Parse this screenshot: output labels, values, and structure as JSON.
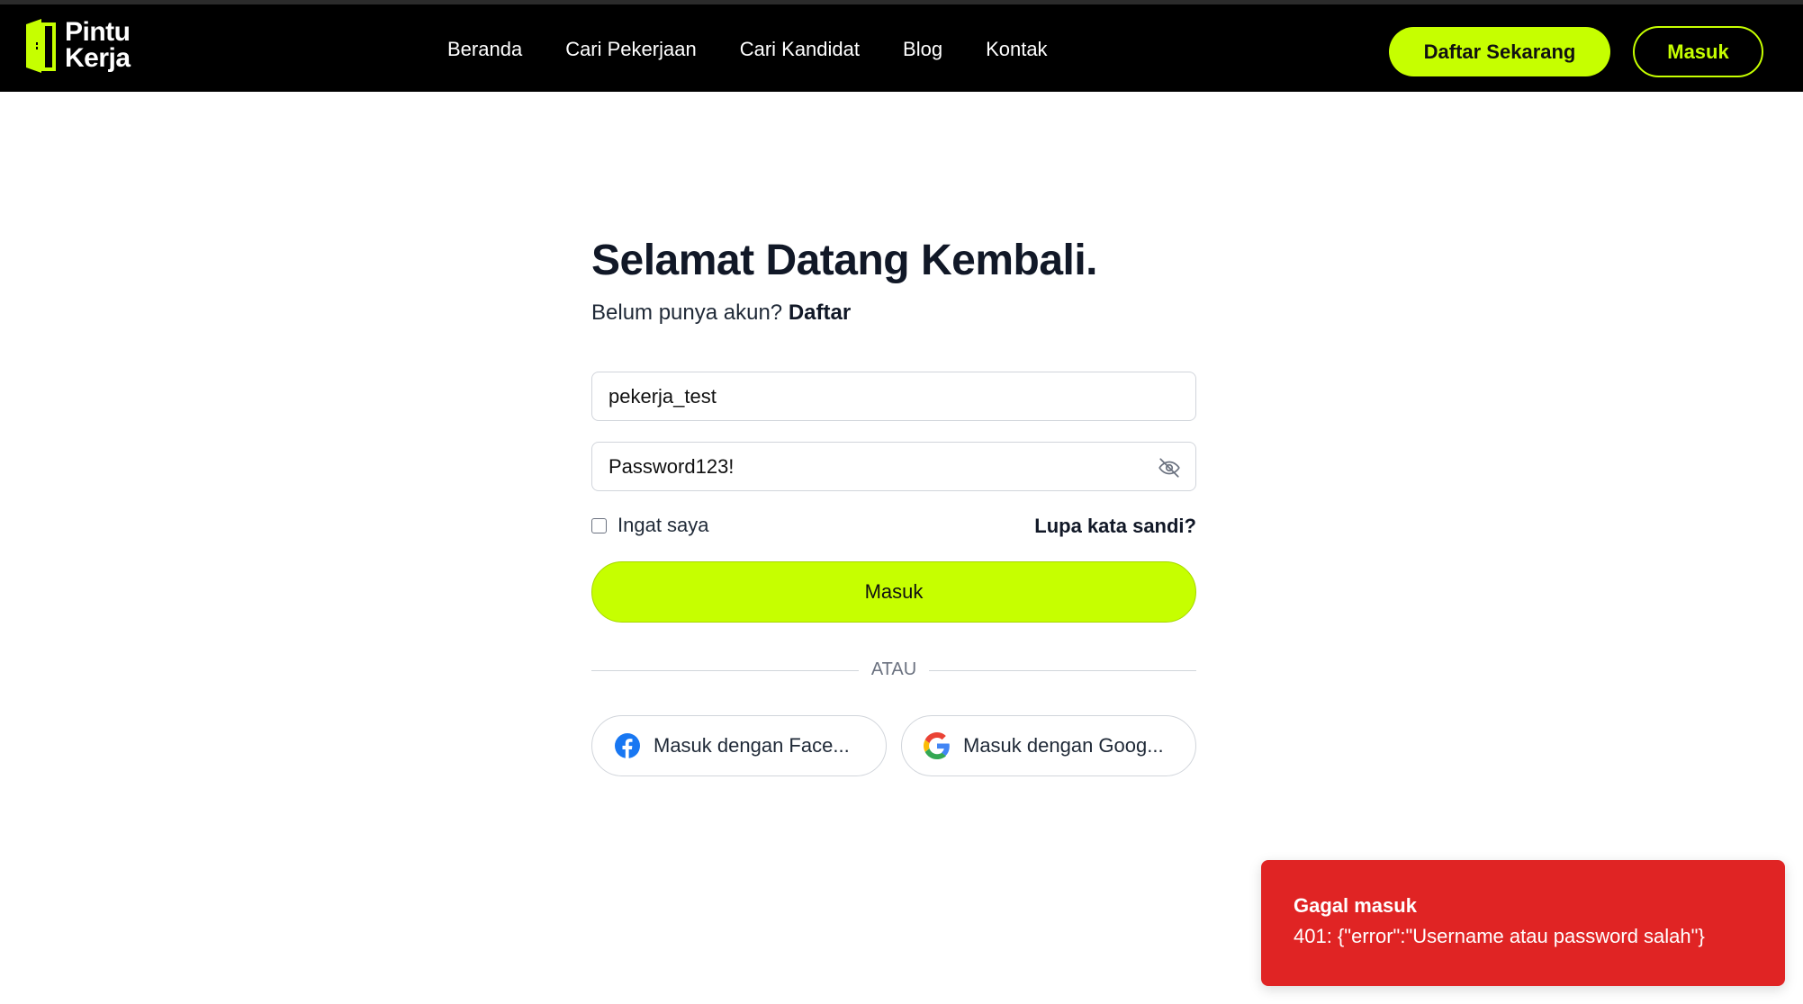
{
  "header": {
    "logo": {
      "line1": "Pintu",
      "line2": "Kerja"
    },
    "nav": [
      "Beranda",
      "Cari Pekerjaan",
      "Cari Kandidat",
      "Blog",
      "Kontak"
    ],
    "register_button": "Daftar Sekarang",
    "login_button": "Masuk"
  },
  "login": {
    "title": "Selamat Datang Kembali.",
    "subtitle_text": "Belum punya akun?",
    "subtitle_link": "Daftar",
    "username_value": "pekerja_test",
    "password_value": "Password123!",
    "remember_label": "Ingat saya",
    "forgot_link": "Lupa kata sandi?",
    "submit_label": "Masuk",
    "divider_text": "ATAU",
    "facebook_label": "Masuk dengan Face...",
    "google_label": "Masuk dengan Goog..."
  },
  "toast": {
    "title": "Gagal masuk",
    "message": "401: {\"error\":\"Username atau password salah\"}"
  },
  "colors": {
    "accent": "#c6ff00",
    "header_bg": "#000000",
    "toast_bg": "#e02424"
  }
}
